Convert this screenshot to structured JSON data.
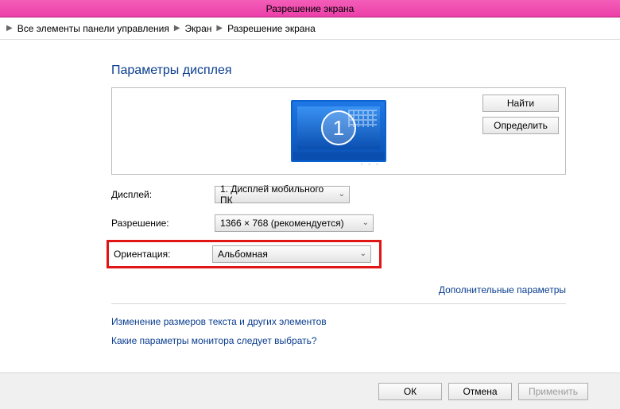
{
  "window": {
    "title": "Разрешение экрана"
  },
  "breadcrumb": {
    "item1": "Все элементы панели управления",
    "item2": "Экран",
    "item3": "Разрешение экрана"
  },
  "heading": "Параметры дисплея",
  "preview": {
    "monitor_number": "1",
    "find_label": "Найти",
    "detect_label": "Определить"
  },
  "form": {
    "display_label": "Дисплей:",
    "display_value": "1. Дисплей мобильного ПК",
    "resolution_label": "Разрешение:",
    "resolution_value": "1366 × 768 (рекомендуется)",
    "orientation_label": "Ориентация:",
    "orientation_value": "Альбомная"
  },
  "advanced_link": "Дополнительные параметры",
  "links": {
    "text_size": "Изменение размеров текста и других элементов",
    "which_monitor": "Какие параметры монитора следует выбрать?"
  },
  "footer": {
    "ok": "ОК",
    "cancel": "Отмена",
    "apply": "Применить"
  }
}
